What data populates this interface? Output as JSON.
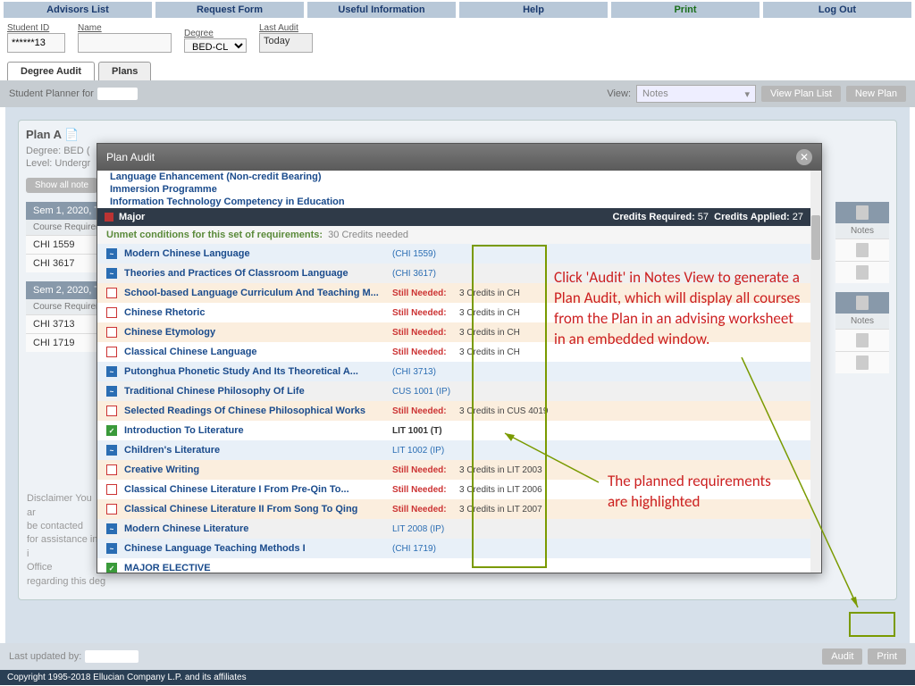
{
  "nav": [
    "Advisors List",
    "Request Form",
    "Useful Information",
    "Help",
    "Print",
    "Log Out"
  ],
  "filters": {
    "studentid_label": "Student ID",
    "studentid_val": "******13",
    "name_label": "Name",
    "name_val": "",
    "degree_label": "Degree",
    "degree_val": "BED-CL",
    "lastaudit_label": "Last Audit",
    "lastaudit_val": "Today"
  },
  "tabs": {
    "degree": "Degree Audit",
    "plans": "Plans"
  },
  "band": {
    "planner_for": "Student Planner for",
    "view": "View:",
    "view_val": "Notes",
    "btn1": "View Plan List",
    "btn2": "New Plan"
  },
  "plan": {
    "title": "Plan A",
    "degree": "Degree: BED (",
    "level": "Level: Undergr",
    "showall": "Show all note",
    "sem1": {
      "hd": "Sem 1, 2020, T",
      "sub": "Course Requiremen",
      "notes": "Notes",
      "c1": "CHI 1559",
      "c2": "CHI 3617"
    },
    "sem2": {
      "hd": "Sem 2, 2020, T",
      "sub": "Course Requiremen",
      "notes": "Notes",
      "c1": "CHI 3713",
      "c2": "CHI 1719"
    }
  },
  "disclaimer": "Disclaimer You ar                                                                                                                                                                                                                                                                                                                                                                     y be contacted\nfor assistance in i                                                                                                                                                                                                                                                                                                                                                                     ar's Office\nregarding this deg",
  "footer": {
    "lastupdated": "Last updated by:",
    "audit": "Audit",
    "print": "Print"
  },
  "copyright": "Copyright 1995-2018 Ellucian Company L.P. and its affiliates",
  "modal": {
    "title": "Plan Audit",
    "links": [
      "Language Enhancement (Non-credit Bearing)",
      "Immersion Programme",
      "Information Technology Competency in Education"
    ],
    "major": "Major",
    "cr_req_lbl": "Credits Required:",
    "cr_req": "57",
    "cr_app_lbl": "Credits Applied:",
    "cr_app": "27",
    "unmet": "Unmet conditions for this set of requirements:",
    "unmet_val": "30 Credits needed",
    "rows": [
      {
        "t": "blue",
        "bg": "bg-ltblue",
        "title": "Modern Chinese Language",
        "code": "(CHI 1559)",
        "extra": ""
      },
      {
        "t": "blue",
        "bg": "bg-grey",
        "title": "Theories and Practices Of Classroom Language",
        "code": "(CHI 3617)",
        "extra": ""
      },
      {
        "t": "red",
        "bg": "bg-ltorange",
        "title": "School-based Language Curriculum And Teaching M...",
        "code": "Still Needed:",
        "extra": "3 Credits in CH"
      },
      {
        "t": "red",
        "bg": "bg-white",
        "title": "Chinese Rhetoric",
        "code": "Still Needed:",
        "extra": "3 Credits in CH"
      },
      {
        "t": "red",
        "bg": "bg-ltorange",
        "title": "Chinese Etymology",
        "code": "Still Needed:",
        "extra": "3 Credits in CH"
      },
      {
        "t": "red",
        "bg": "bg-white",
        "title": "Classical Chinese Language",
        "code": "Still Needed:",
        "extra": "3 Credits in CH"
      },
      {
        "t": "blue",
        "bg": "bg-ltblue",
        "title": "Putonghua Phonetic Study And Its Theoretical A...",
        "code": "(CHI 3713)",
        "extra": ""
      },
      {
        "t": "blue",
        "bg": "bg-grey",
        "title": "Traditional Chinese Philosophy Of Life",
        "code": "CUS 1001 (IP)",
        "extra": ""
      },
      {
        "t": "red",
        "bg": "bg-ltorange",
        "title": "Selected Readings Of Chinese Philosophical Works",
        "code": "Still Needed:",
        "extra": "3 Credits in CUS 4019"
      },
      {
        "t": "green",
        "bg": "bg-white",
        "title": "Introduction To Literature",
        "code": "LIT 1001 (T)",
        "extra": ""
      },
      {
        "t": "blue",
        "bg": "bg-ltblue",
        "title": "Children's Literature",
        "code": "LIT 1002 (IP)",
        "extra": ""
      },
      {
        "t": "red",
        "bg": "bg-ltorange",
        "title": "Creative Writing",
        "code": "Still Needed:",
        "extra": "3 Credits in LIT 2003"
      },
      {
        "t": "red",
        "bg": "bg-white",
        "title": "Classical Chinese Literature I From Pre-Qin To...",
        "code": "Still Needed:",
        "extra": "3 Credits in LIT 2006"
      },
      {
        "t": "red",
        "bg": "bg-ltorange",
        "title": "Classical Chinese Literature II From Song To Qing",
        "code": "Still Needed:",
        "extra": "3 Credits in LIT 2007"
      },
      {
        "t": "blue",
        "bg": "bg-grey",
        "title": "Modern Chinese Literature",
        "code": "LIT 2008 (IP)",
        "extra": ""
      },
      {
        "t": "blue",
        "bg": "bg-ltblue",
        "title": "Chinese Language Teaching Methods I",
        "code": "(CHI 1719)",
        "extra": ""
      },
      {
        "t": "green",
        "bg": "bg-white",
        "title": "MAJOR ELECTIVE",
        "code": "",
        "extra": ""
      }
    ]
  },
  "callouts": {
    "c1": "Click 'Audit' in Notes View to generate a Plan Audit, which will display all courses from the Plan in an advising worksheet in an embedded window.",
    "c2": "The planned requirements are highlighted"
  }
}
